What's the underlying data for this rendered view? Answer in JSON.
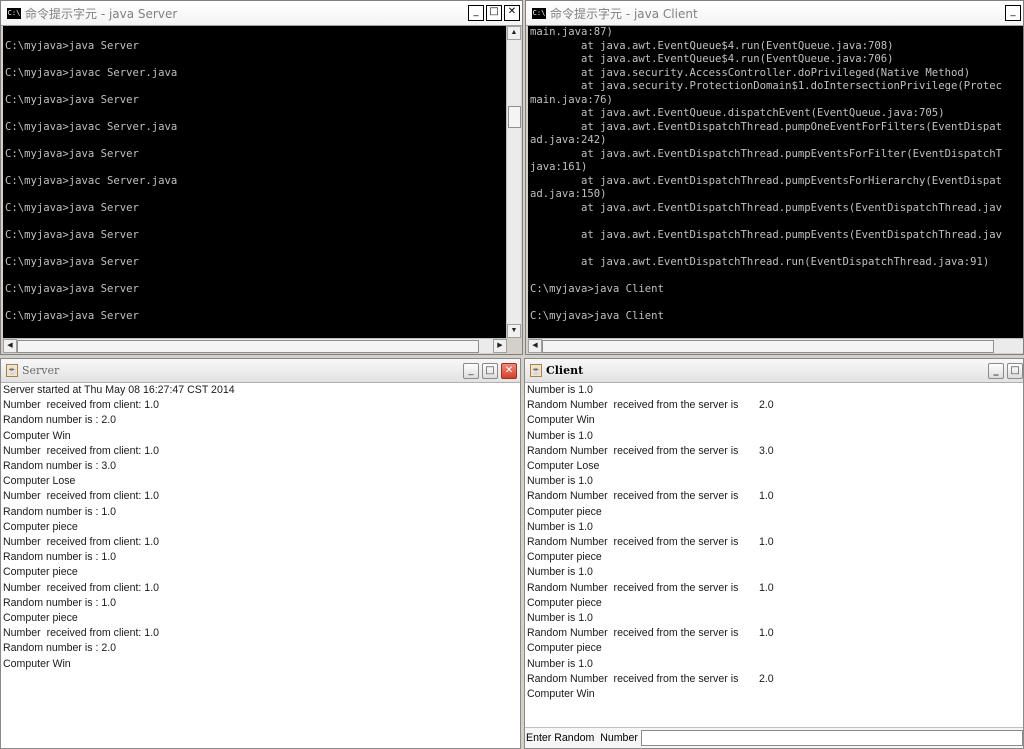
{
  "server_cmd": {
    "title": "命令提示字元 - java Server",
    "console": "\nC:\\myjava>java Server\n\nC:\\myjava>javac Server.java\n\nC:\\myjava>java Server\n\nC:\\myjava>javac Server.java\n\nC:\\myjava>java Server\n\nC:\\myjava>javac Server.java\n\nC:\\myjava>java Server\n\nC:\\myjava>java Server\n\nC:\\myjava>java Server\n\nC:\\myjava>java Server\n\nC:\\myjava>java Server"
  },
  "client_cmd": {
    "title": "命令提示字元 - java Client",
    "console": "main.java:87)\n        at java.awt.EventQueue$4.run(EventQueue.java:708)\n        at java.awt.EventQueue$4.run(EventQueue.java:706)\n        at java.security.AccessController.doPrivileged(Native Method)\n        at java.security.ProtectionDomain$1.doIntersectionPrivilege(Protec\nmain.java:76)\n        at java.awt.EventQueue.dispatchEvent(EventQueue.java:705)\n        at java.awt.EventDispatchThread.pumpOneEventForFilters(EventDispat\nad.java:242)\n        at java.awt.EventDispatchThread.pumpEventsForFilter(EventDispatchT\njava:161)\n        at java.awt.EventDispatchThread.pumpEventsForHierarchy(EventDispat\nad.java:150)\n        at java.awt.EventDispatchThread.pumpEvents(EventDispatchThread.jav\n\n        at java.awt.EventDispatchThread.pumpEvents(EventDispatchThread.jav\n\n        at java.awt.EventDispatchThread.run(EventDispatchThread.java:91)\n\nC:\\myjava>java Client\n\nC:\\myjava>java Client"
  },
  "server_window": {
    "title": "Server",
    "text": "Server started at Thu May 08 16:27:47 CST 2014\nNumber  received from client: 1.0\nRandom number is : 2.0\nComputer Win\nNumber  received from client: 1.0\nRandom number is : 3.0\nComputer Lose\nNumber  received from client: 1.0\nRandom number is : 1.0\nComputer piece\nNumber  received from client: 1.0\nRandom number is : 1.0\nComputer piece\nNumber  received from client: 1.0\nRandom number is : 1.0\nComputer piece\nNumber  received from client: 1.0\nRandom number is : 2.0\nComputer Win"
  },
  "client_window": {
    "title": "Client",
    "text": "Number is 1.0\nRandom Number  received from the server is       2.0\nComputer Win\nNumber is 1.0\nRandom Number  received from the server is       3.0\nComputer Lose\nNumber is 1.0\nRandom Number  received from the server is       1.0\nComputer piece\nNumber is 1.0\nRandom Number  received from the server is       1.0\nComputer piece\nNumber is 1.0\nRandom Number  received from the server is       1.0\nComputer piece\nNumber is 1.0\nRandom Number  received from the server is       1.0\nComputer piece\nNumber is 1.0\nRandom Number  received from the server is       2.0\nComputer Win",
    "input_label": "Enter Random  Number",
    "input_value": ""
  },
  "icons": {
    "cmd": "C:\\",
    "java": "☕",
    "minimize": "_",
    "maximize": "□",
    "close": "✕"
  }
}
